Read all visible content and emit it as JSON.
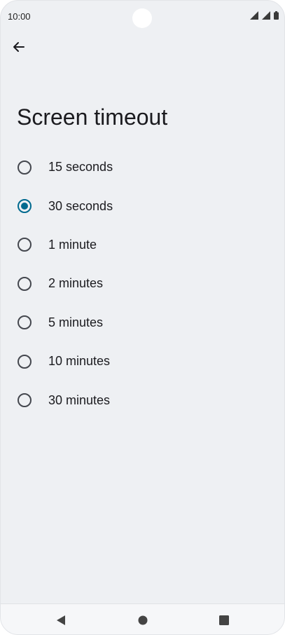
{
  "status_bar": {
    "time": "10:00",
    "icons": [
      "signal-icon",
      "signal-icon",
      "battery-icon"
    ]
  },
  "header": {
    "back_icon": "arrow-back-icon",
    "title": "Screen timeout"
  },
  "options": [
    {
      "label": "15 seconds",
      "selected": false
    },
    {
      "label": "30 seconds",
      "selected": true
    },
    {
      "label": "1 minute",
      "selected": false
    },
    {
      "label": "2 minutes",
      "selected": false
    },
    {
      "label": "5 minutes",
      "selected": false
    },
    {
      "label": "10 minutes",
      "selected": false
    },
    {
      "label": "30 minutes",
      "selected": false
    }
  ],
  "nav_bar": {
    "buttons": [
      "back-triangle-icon",
      "home-circle-icon",
      "recents-square-icon"
    ]
  },
  "colors": {
    "accent": "#006a8f",
    "background": "#eef0f3",
    "text": "#1b1b1f"
  }
}
